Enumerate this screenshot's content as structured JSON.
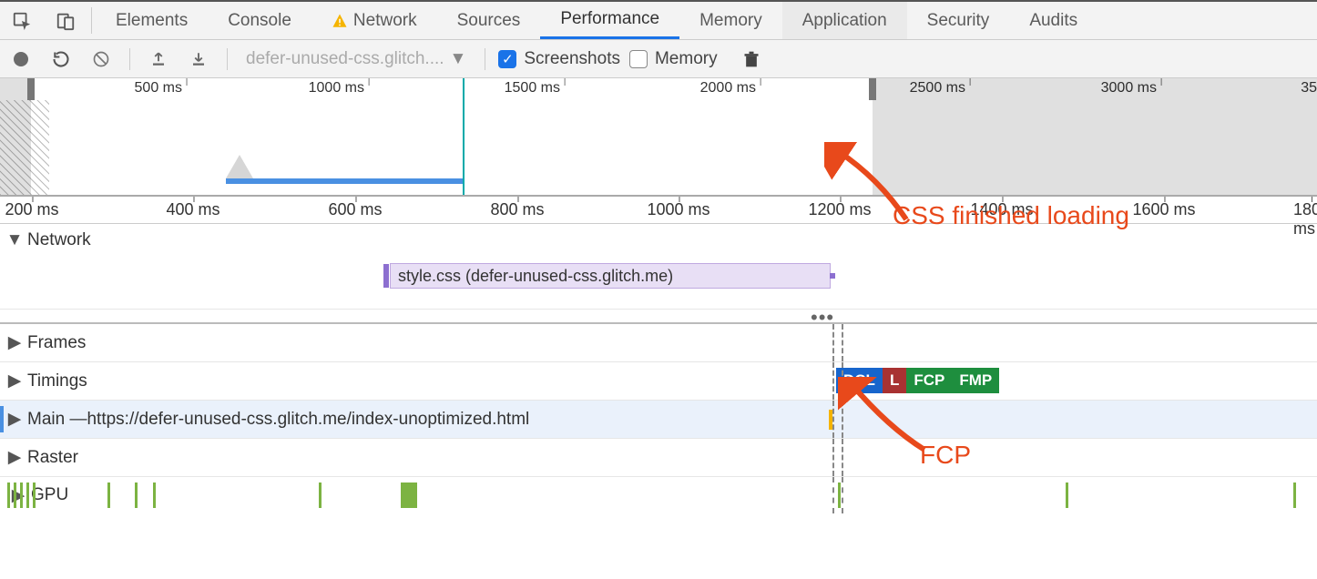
{
  "tabs": {
    "items": [
      "Elements",
      "Console",
      "Network",
      "Sources",
      "Performance",
      "Memory",
      "Application",
      "Security",
      "Audits"
    ],
    "active": "Performance",
    "warning_on": "Network"
  },
  "toolbar": {
    "profile_dropdown": "defer-unused-css.glitch....",
    "screenshots_label": "Screenshots",
    "memory_label": "Memory",
    "screenshots_checked": true,
    "memory_checked": false
  },
  "overview_ruler": {
    "ticks": [
      "500 ms",
      "1000 ms",
      "1500 ms",
      "2000 ms",
      "2500 ms",
      "3000 ms",
      "35"
    ]
  },
  "detail_ruler": {
    "ticks": [
      "200 ms",
      "400 ms",
      "600 ms",
      "800 ms",
      "1000 ms",
      "1200 ms",
      "1400 ms",
      "1600 ms",
      "1800 ms"
    ]
  },
  "tracks": {
    "network_label": "Network",
    "network_request": "style.css (defer-unused-css.glitch.me)",
    "frames_label": "Frames",
    "timings_label": "Timings",
    "timing_markers": {
      "dcl": "DCL",
      "l": "L",
      "fcp": "FCP",
      "fmp": "FMP"
    },
    "main_label_prefix": "Main — ",
    "main_url": "https://defer-unused-css.glitch.me/index-unoptimized.html",
    "raster_label": "Raster",
    "gpu_label": "GPU"
  },
  "annotations": {
    "css_finished": "CSS finished loading",
    "fcp": "FCP"
  }
}
